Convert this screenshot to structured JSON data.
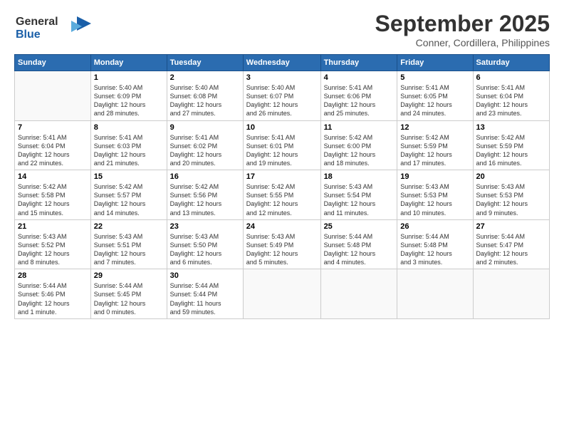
{
  "header": {
    "logo_line1": "General",
    "logo_line2": "Blue",
    "month": "September 2025",
    "location": "Conner, Cordillera, Philippines"
  },
  "weekdays": [
    "Sunday",
    "Monday",
    "Tuesday",
    "Wednesday",
    "Thursday",
    "Friday",
    "Saturday"
  ],
  "weeks": [
    [
      {
        "day": "",
        "info": ""
      },
      {
        "day": "1",
        "info": "Sunrise: 5:40 AM\nSunset: 6:09 PM\nDaylight: 12 hours\nand 28 minutes."
      },
      {
        "day": "2",
        "info": "Sunrise: 5:40 AM\nSunset: 6:08 PM\nDaylight: 12 hours\nand 27 minutes."
      },
      {
        "day": "3",
        "info": "Sunrise: 5:40 AM\nSunset: 6:07 PM\nDaylight: 12 hours\nand 26 minutes."
      },
      {
        "day": "4",
        "info": "Sunrise: 5:41 AM\nSunset: 6:06 PM\nDaylight: 12 hours\nand 25 minutes."
      },
      {
        "day": "5",
        "info": "Sunrise: 5:41 AM\nSunset: 6:05 PM\nDaylight: 12 hours\nand 24 minutes."
      },
      {
        "day": "6",
        "info": "Sunrise: 5:41 AM\nSunset: 6:04 PM\nDaylight: 12 hours\nand 23 minutes."
      }
    ],
    [
      {
        "day": "7",
        "info": "Sunrise: 5:41 AM\nSunset: 6:04 PM\nDaylight: 12 hours\nand 22 minutes."
      },
      {
        "day": "8",
        "info": "Sunrise: 5:41 AM\nSunset: 6:03 PM\nDaylight: 12 hours\nand 21 minutes."
      },
      {
        "day": "9",
        "info": "Sunrise: 5:41 AM\nSunset: 6:02 PM\nDaylight: 12 hours\nand 20 minutes."
      },
      {
        "day": "10",
        "info": "Sunrise: 5:41 AM\nSunset: 6:01 PM\nDaylight: 12 hours\nand 19 minutes."
      },
      {
        "day": "11",
        "info": "Sunrise: 5:42 AM\nSunset: 6:00 PM\nDaylight: 12 hours\nand 18 minutes."
      },
      {
        "day": "12",
        "info": "Sunrise: 5:42 AM\nSunset: 5:59 PM\nDaylight: 12 hours\nand 17 minutes."
      },
      {
        "day": "13",
        "info": "Sunrise: 5:42 AM\nSunset: 5:59 PM\nDaylight: 12 hours\nand 16 minutes."
      }
    ],
    [
      {
        "day": "14",
        "info": "Sunrise: 5:42 AM\nSunset: 5:58 PM\nDaylight: 12 hours\nand 15 minutes."
      },
      {
        "day": "15",
        "info": "Sunrise: 5:42 AM\nSunset: 5:57 PM\nDaylight: 12 hours\nand 14 minutes."
      },
      {
        "day": "16",
        "info": "Sunrise: 5:42 AM\nSunset: 5:56 PM\nDaylight: 12 hours\nand 13 minutes."
      },
      {
        "day": "17",
        "info": "Sunrise: 5:42 AM\nSunset: 5:55 PM\nDaylight: 12 hours\nand 12 minutes."
      },
      {
        "day": "18",
        "info": "Sunrise: 5:43 AM\nSunset: 5:54 PM\nDaylight: 12 hours\nand 11 minutes."
      },
      {
        "day": "19",
        "info": "Sunrise: 5:43 AM\nSunset: 5:53 PM\nDaylight: 12 hours\nand 10 minutes."
      },
      {
        "day": "20",
        "info": "Sunrise: 5:43 AM\nSunset: 5:53 PM\nDaylight: 12 hours\nand 9 minutes."
      }
    ],
    [
      {
        "day": "21",
        "info": "Sunrise: 5:43 AM\nSunset: 5:52 PM\nDaylight: 12 hours\nand 8 minutes."
      },
      {
        "day": "22",
        "info": "Sunrise: 5:43 AM\nSunset: 5:51 PM\nDaylight: 12 hours\nand 7 minutes."
      },
      {
        "day": "23",
        "info": "Sunrise: 5:43 AM\nSunset: 5:50 PM\nDaylight: 12 hours\nand 6 minutes."
      },
      {
        "day": "24",
        "info": "Sunrise: 5:43 AM\nSunset: 5:49 PM\nDaylight: 12 hours\nand 5 minutes."
      },
      {
        "day": "25",
        "info": "Sunrise: 5:44 AM\nSunset: 5:48 PM\nDaylight: 12 hours\nand 4 minutes."
      },
      {
        "day": "26",
        "info": "Sunrise: 5:44 AM\nSunset: 5:48 PM\nDaylight: 12 hours\nand 3 minutes."
      },
      {
        "day": "27",
        "info": "Sunrise: 5:44 AM\nSunset: 5:47 PM\nDaylight: 12 hours\nand 2 minutes."
      }
    ],
    [
      {
        "day": "28",
        "info": "Sunrise: 5:44 AM\nSunset: 5:46 PM\nDaylight: 12 hours\nand 1 minute."
      },
      {
        "day": "29",
        "info": "Sunrise: 5:44 AM\nSunset: 5:45 PM\nDaylight: 12 hours\nand 0 minutes."
      },
      {
        "day": "30",
        "info": "Sunrise: 5:44 AM\nSunset: 5:44 PM\nDaylight: 11 hours\nand 59 minutes."
      },
      {
        "day": "",
        "info": ""
      },
      {
        "day": "",
        "info": ""
      },
      {
        "day": "",
        "info": ""
      },
      {
        "day": "",
        "info": ""
      }
    ]
  ]
}
